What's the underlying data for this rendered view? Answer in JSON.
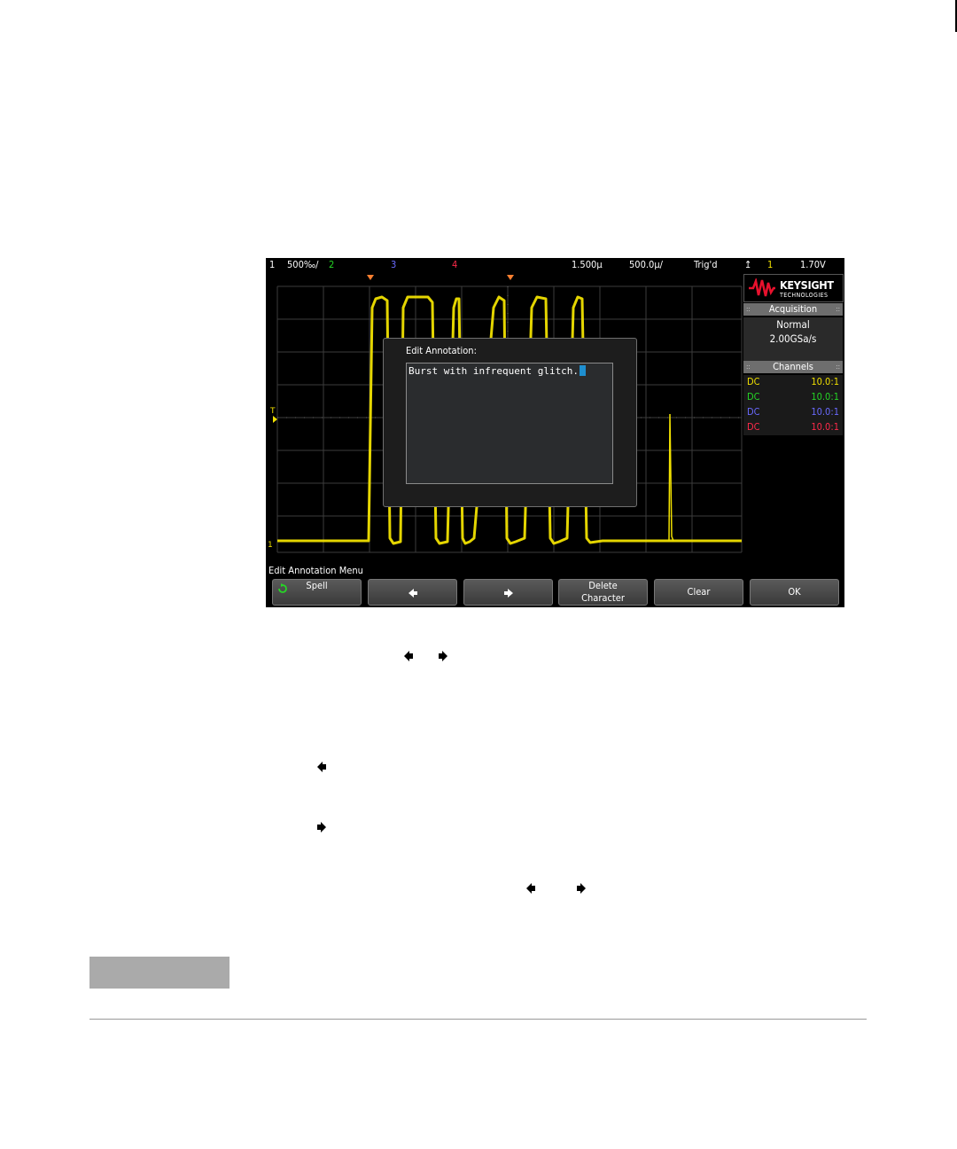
{
  "status_bar": {
    "ch1_num": "1",
    "ch1_scale": "500‰/",
    "ch2_num": "2",
    "ch3_num": "3",
    "ch4_num": "4",
    "delay": "1.500µ",
    "timebase": "500.0µ/",
    "trig_status": "Trig'd",
    "trig_src": "1",
    "trig_level": "1.70V"
  },
  "logo": {
    "brand": "KEYSIGHT",
    "sub": "TECHNOLOGIES"
  },
  "acquisition": {
    "header": "Acquisition",
    "mode": "Normal",
    "rate": "2.00GSa/s"
  },
  "channels": {
    "header": "Channels",
    "rows": [
      {
        "coupling": "DC",
        "probe": "10.0:1",
        "color": "#f0e000"
      },
      {
        "coupling": "DC",
        "probe": "10.0:1",
        "color": "#25d725"
      },
      {
        "coupling": "DC",
        "probe": "10.0:1",
        "color": "#6a6aff"
      },
      {
        "coupling": "DC",
        "probe": "10.0:1",
        "color": "#ff2a4a"
      }
    ]
  },
  "dialog": {
    "title": "Edit Annotation:",
    "text": "Burst with infrequent glitch."
  },
  "menu": {
    "title": "Edit Annotation Menu",
    "softkeys": [
      "Spell",
      "",
      "",
      "Delete",
      "Character",
      "Clear",
      "OK"
    ]
  },
  "markers": {
    "trigger_marker": "T",
    "ground_marker": "1"
  },
  "colors": {
    "trace": "#f0e000",
    "background": "#000000",
    "cursor": "#1e8fd0"
  }
}
